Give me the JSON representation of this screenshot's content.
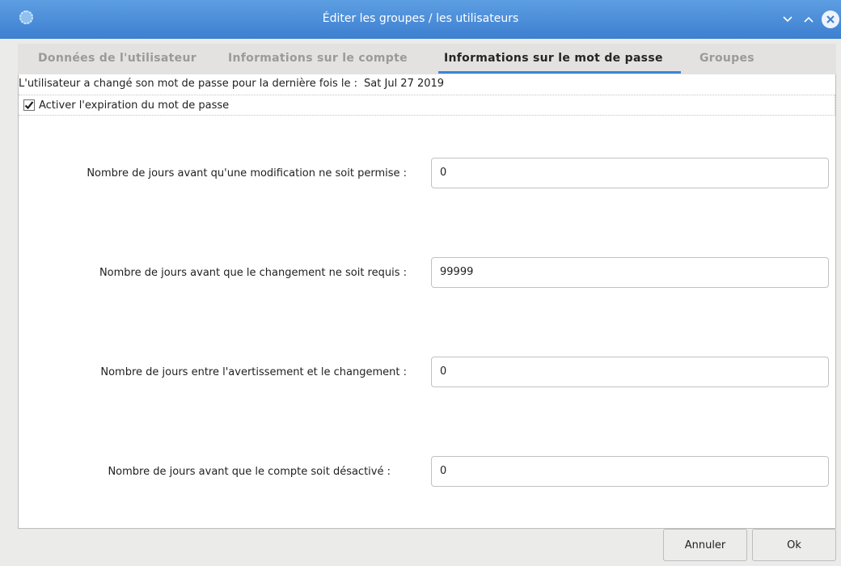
{
  "window": {
    "title": "Éditer les groupes / les utilisateurs",
    "app_icon": "gear-flower-icon"
  },
  "tabs": [
    {
      "label": "Données de l'utilisateur",
      "active": false
    },
    {
      "label": "Informations sur le compte",
      "active": false
    },
    {
      "label": "Informations sur le mot de passe",
      "active": true
    },
    {
      "label": "Groupes",
      "active": false
    }
  ],
  "password_info": {
    "last_change_label": "L'utilisateur a changé son mot de passe pour la dernière fois le :",
    "last_change_date": "Sat Jul 27 2019",
    "expiration_checkbox_label": "Activer l'expiration du mot de passe",
    "expiration_checked": true,
    "fields": [
      {
        "label": "Nombre de jours avant qu'une modification ne soit permise :",
        "value": "0"
      },
      {
        "label": "Nombre de jours avant que le changement ne soit requis :",
        "value": "99999"
      },
      {
        "label": "Nombre de jours entre l'avertissement et le changement :",
        "value": "0"
      },
      {
        "label": "Nombre de jours avant que le compte soit désactivé :",
        "value": "0"
      }
    ]
  },
  "buttons": {
    "cancel": "Annuler",
    "ok": "Ok"
  },
  "colors": {
    "titlebar": "#4a8ad8",
    "active_tab_underline": "#3a86d9"
  }
}
